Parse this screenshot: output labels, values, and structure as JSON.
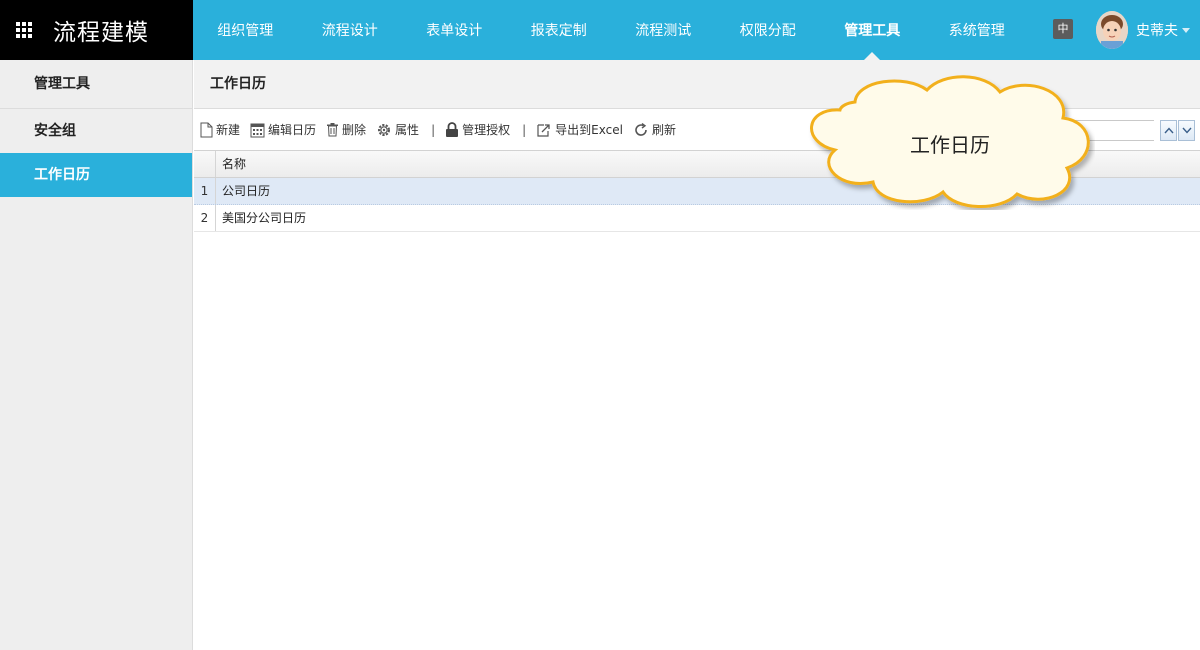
{
  "app": {
    "title": "流程建模"
  },
  "nav": {
    "items": [
      {
        "label": "组织管理"
      },
      {
        "label": "流程设计"
      },
      {
        "label": "表单设计"
      },
      {
        "label": "报表定制"
      },
      {
        "label": "流程测试"
      },
      {
        "label": "权限分配"
      },
      {
        "label": "管理工具"
      },
      {
        "label": "系统管理"
      }
    ],
    "active_index": 6
  },
  "header_right": {
    "lang_label": "中",
    "user_name": "史蒂夫"
  },
  "sidebar": {
    "header": "管理工具",
    "items": [
      {
        "label": "安全组"
      },
      {
        "label": "工作日历"
      }
    ],
    "active_index": 1
  },
  "main": {
    "title": "工作日历"
  },
  "toolbar": {
    "new_label": "新建",
    "edit_calendar_label": "编辑日历",
    "delete_label": "删除",
    "properties_label": "属性",
    "separator": "|",
    "manage_auth_label": "管理授权",
    "export_label": "导出到Excel",
    "refresh_label": "刷新"
  },
  "grid": {
    "columns": [
      "名称"
    ],
    "rows": [
      {
        "num": "1",
        "name": "公司日历"
      },
      {
        "num": "2",
        "name": "美国分公司日历"
      }
    ],
    "selected_index": 0
  },
  "callout": {
    "text": "工作日历"
  },
  "colors": {
    "accent": "#2ab0db",
    "brand_bg": "#000000",
    "callout_border": "#f2b01e"
  },
  "icons": [
    "apps-grid-icon",
    "new-document-icon",
    "calendar-icon",
    "trash-icon",
    "gear-icon",
    "lock-icon",
    "export-icon",
    "refresh-icon",
    "chevron-up-icon",
    "chevron-down-icon",
    "caret-down-icon"
  ]
}
